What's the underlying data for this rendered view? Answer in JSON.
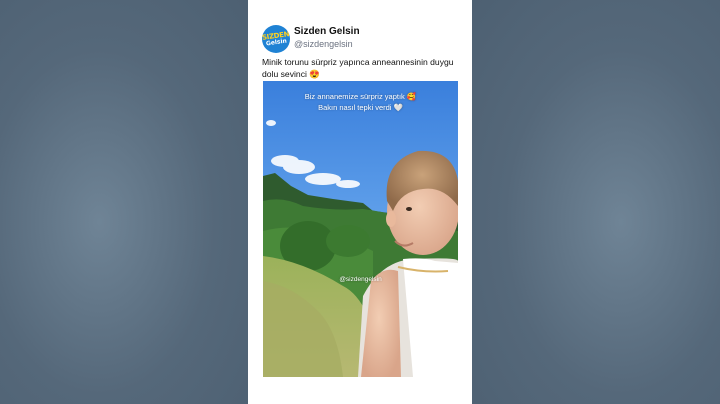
{
  "post": {
    "account_name": "Sizden Gelsin",
    "handle": "@sizdengelsin",
    "avatar_text_line1": "SIZDEN",
    "avatar_text_line2": "Gelsin",
    "text": "Minik torunu sürpriz yapınca anneannesinin duygu dolu sevinci 😍"
  },
  "media": {
    "caption_line1": "Biz annanemize sürpriz yaptık 🥰",
    "caption_line2": "Bakın nasıl tepki verdi 🤍",
    "watermark": "@sizdengelsin"
  },
  "colors": {
    "background": "#56687a",
    "card": "#ffffff",
    "avatar": "#1f82d4",
    "sky": "#3f86e0"
  }
}
